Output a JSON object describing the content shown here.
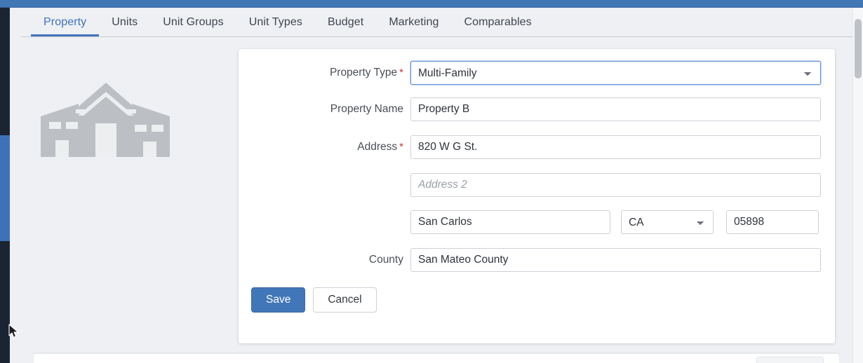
{
  "app": {
    "accent_blue": "#4277b6",
    "nav_dark": "#1b2432",
    "nav_active_blue": "#3d72b8",
    "page_bg": "#eef0f3",
    "required_marker_color": "#c8372d",
    "focus_border_color": "#5b8fd4"
  },
  "tabs": [
    {
      "label": "Property",
      "active": true
    },
    {
      "label": "Units",
      "active": false
    },
    {
      "label": "Unit Groups",
      "active": false
    },
    {
      "label": "Unit Types",
      "active": false
    },
    {
      "label": "Budget",
      "active": false
    },
    {
      "label": "Marketing",
      "active": false
    },
    {
      "label": "Comparables",
      "active": false
    }
  ],
  "thumbnail": {
    "icon": "house-placeholder-icon",
    "color": "#bcc0c4"
  },
  "form": {
    "property_type": {
      "label": "Property Type",
      "required_marker": "*",
      "value": "Multi-Family",
      "options": [
        "Multi-Family"
      ],
      "icon": "chevron-down-icon"
    },
    "property_name": {
      "label": "Property Name",
      "value": "Property B",
      "placeholder": ""
    },
    "address": {
      "label": "Address",
      "required_marker": "*",
      "value": "820 W G St.",
      "placeholder": ""
    },
    "address2": {
      "label": "",
      "value": "",
      "placeholder": "Address 2"
    },
    "city": {
      "label": "",
      "value": "San Carlos",
      "placeholder": ""
    },
    "state": {
      "label": "",
      "value": "CA",
      "options": [
        "CA"
      ],
      "icon": "chevron-down-icon"
    },
    "zip": {
      "label": "",
      "value": "05898",
      "placeholder": ""
    },
    "county": {
      "label": "County",
      "value": "San Mateo County",
      "placeholder": ""
    }
  },
  "actions": {
    "save_label": "Save",
    "cancel_label": "Cancel",
    "save_color": "#4176b8"
  },
  "scrollbar": {
    "name": "vertical-scrollbar",
    "thumb_color": "#bec2c7"
  }
}
